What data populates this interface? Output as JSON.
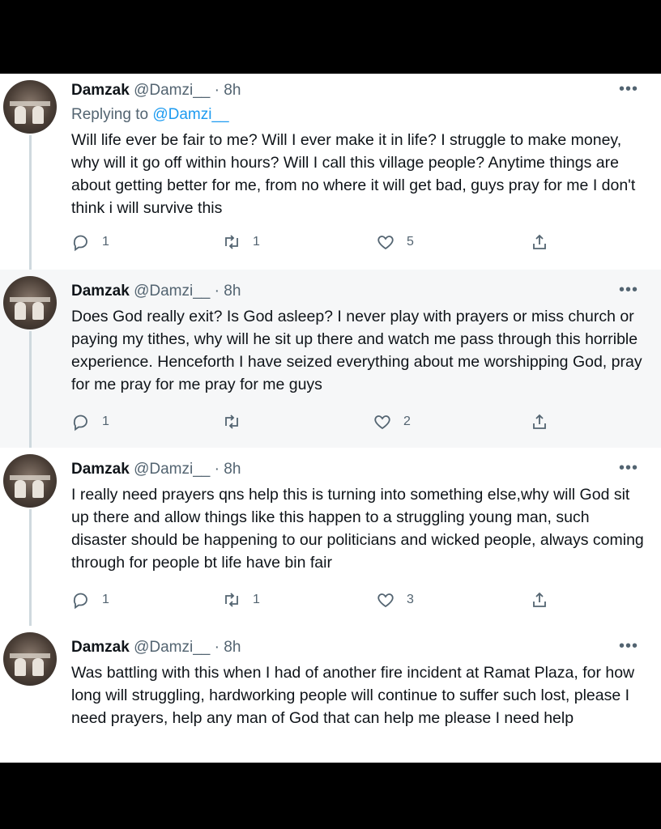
{
  "tweets": [
    {
      "name": "Damzak",
      "handle": "@Damzi__",
      "time": "· 8h",
      "more": "•••",
      "replying_label": "Replying to",
      "replying_handle": "@Damzi__",
      "text": "Will life ever be fair to me? Will I ever make it in life? I struggle to make money, why will it go off within hours? Will I call this village people? Anytime things are about getting better for me, from no where it will get bad, guys pray for me I don't think i will survive this",
      "replies": "1",
      "retweets": "1",
      "likes": "5"
    },
    {
      "name": "Damzak",
      "handle": "@Damzi__",
      "time": "· 8h",
      "more": "•••",
      "text": "Does God really exit? Is God asleep? I never play with prayers or miss church or paying my tithes, why will he sit up there and watch me pass through this horrible experience. Henceforth I have seized everything about me worshipping God, pray for me pray for me pray for me guys",
      "replies": "1",
      "retweets": "",
      "likes": "2"
    },
    {
      "name": "Damzak",
      "handle": "@Damzi__",
      "time": "· 8h",
      "more": "•••",
      "text": "I really need prayers qns help this is turning into something else,why will God sit up there and allow things like this happen to a struggling young man, such disaster should be happening to our politicians and wicked people, always coming through for people bt life have bin fair",
      "replies": "1",
      "retweets": "1",
      "likes": "3"
    },
    {
      "name": "Damzak",
      "handle": "@Damzi__",
      "time": "· 8h",
      "more": "•••",
      "text": "Was battling with this when I had of another fire incident at Ramat Plaza, for how long will struggling, hardworking people will continue to suffer such lost, please I need prayers, help any man of God that can help me please I need help"
    }
  ],
  "icons": [
    "reply-icon",
    "retweet-icon",
    "like-icon",
    "share-icon",
    "more-icon"
  ],
  "colors": {
    "text": "#0f1419",
    "muted": "#536471",
    "link": "#1d9bf0",
    "thread": "#cfd9de",
    "alt_bg": "#f6f7f8"
  }
}
